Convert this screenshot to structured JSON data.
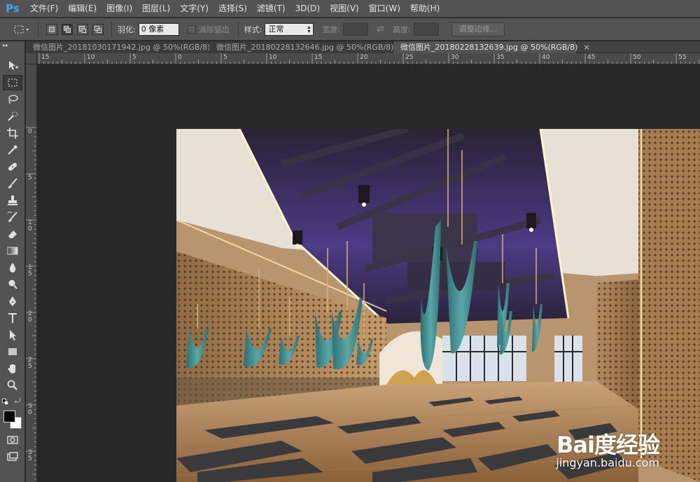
{
  "app": {
    "logo": "Ps",
    "brand_color": "#31a8ff"
  },
  "menu": [
    {
      "label": "文件(F)"
    },
    {
      "label": "编辑(E)"
    },
    {
      "label": "图像(I)"
    },
    {
      "label": "图层(L)"
    },
    {
      "label": "文字(Y)"
    },
    {
      "label": "选择(S)"
    },
    {
      "label": "滤镜(T)"
    },
    {
      "label": "3D(D)"
    },
    {
      "label": "视图(V)"
    },
    {
      "label": "窗口(W)"
    },
    {
      "label": "帮助(H)"
    }
  ],
  "options": {
    "feather_label": "羽化:",
    "feather_value": "0 像素",
    "antialias_label": "消除锯齿",
    "style_label": "样式:",
    "style_value": "正常",
    "width_label": "宽度:",
    "height_label": "高度:",
    "refine_button": "调整边缘..."
  },
  "tabs": [
    {
      "label": "微信图片_20181030171942.jpg @ 50%(RGB/8)",
      "close": "×"
    },
    {
      "label": "微信图片_20180228132646.jpg @ 50%(RGB/8)",
      "close": "×"
    },
    {
      "label": "微信图片_20180228132639.jpg @ 50%(RGB/8)",
      "close": "×"
    }
  ],
  "ruler": {
    "horizontal": [
      "15",
      "10",
      "5",
      "0",
      "5",
      "10",
      "15",
      "20",
      "25",
      "30",
      "35",
      "40",
      "45",
      "50",
      "55"
    ],
    "vertical": [
      "0",
      "5",
      "1 0",
      "1 5",
      "2 0",
      "2 5",
      "3 0",
      "3 5"
    ]
  },
  "watermark": {
    "logo": "Bai度经验",
    "url": "jingyan.baidu.com"
  },
  "colors": {
    "foreground": "#000000",
    "background": "#ffffff",
    "ceiling_light": "#6a4fb5",
    "silk_hammock": "#3f8f93",
    "wood_floor": "#b98a5b"
  }
}
